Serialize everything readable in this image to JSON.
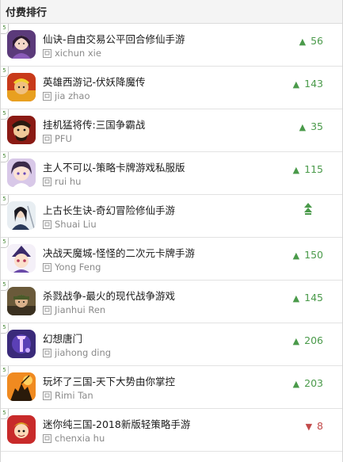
{
  "header": {
    "title": "付费排行"
  },
  "colors": {
    "up": "#4a9a4a",
    "down": "#c24a4a",
    "rank_tab": "#4b8a3a"
  },
  "rows": [
    {
      "rank_label": "5",
      "title": "仙诀-自由交易公平回合修仙手游",
      "developer": "xichun xie",
      "trend": "up",
      "change": "56",
      "icon": "cultivator-girl-icon"
    },
    {
      "rank_label": "5",
      "title": "英雄西游记-伏妖降魔传",
      "developer": "jia zhao",
      "trend": "up",
      "change": "143",
      "icon": "monkey-king-icon"
    },
    {
      "rank_label": "5",
      "title": "挂机猛将传:三国争霸战",
      "developer": "PFU",
      "trend": "up",
      "change": "35",
      "icon": "general-warrior-icon"
    },
    {
      "rank_label": "5",
      "title": "主人不可以-策略卡牌游戏私服版",
      "developer": "rui hu",
      "trend": "up",
      "change": "115",
      "icon": "anime-girl-icon"
    },
    {
      "rank_label": "5",
      "title": "上古长生诀-奇幻冒险修仙手游",
      "developer": "Shuai Liu",
      "trend": "new",
      "change": "",
      "icon": "swordsman-icon"
    },
    {
      "rank_label": "5",
      "title": "决战天魔城-怪怪的二次元卡牌手游",
      "developer": "Yong Feng",
      "trend": "up",
      "change": "150",
      "icon": "chibi-mage-icon"
    },
    {
      "rank_label": "5",
      "title": "杀戮战争-最火的现代战争游戏",
      "developer": "Jianhui Ren",
      "trend": "up",
      "change": "145",
      "icon": "soldier-icon"
    },
    {
      "rank_label": "5",
      "title": "幻想唐门",
      "developer": "jiahong ding",
      "trend": "up",
      "change": "206",
      "icon": "tang-sect-icon"
    },
    {
      "rank_label": "5",
      "title": "玩坏了三国-天下大势由你掌控",
      "developer": "Rimi Tan",
      "trend": "up",
      "change": "203",
      "icon": "warrior-silhouette-icon"
    },
    {
      "rank_label": "5",
      "title": "迷你纯三国-2018新版轻策略手游",
      "developer": "chenxia hu",
      "trend": "down",
      "change": "8",
      "icon": "mini-general-icon"
    }
  ]
}
